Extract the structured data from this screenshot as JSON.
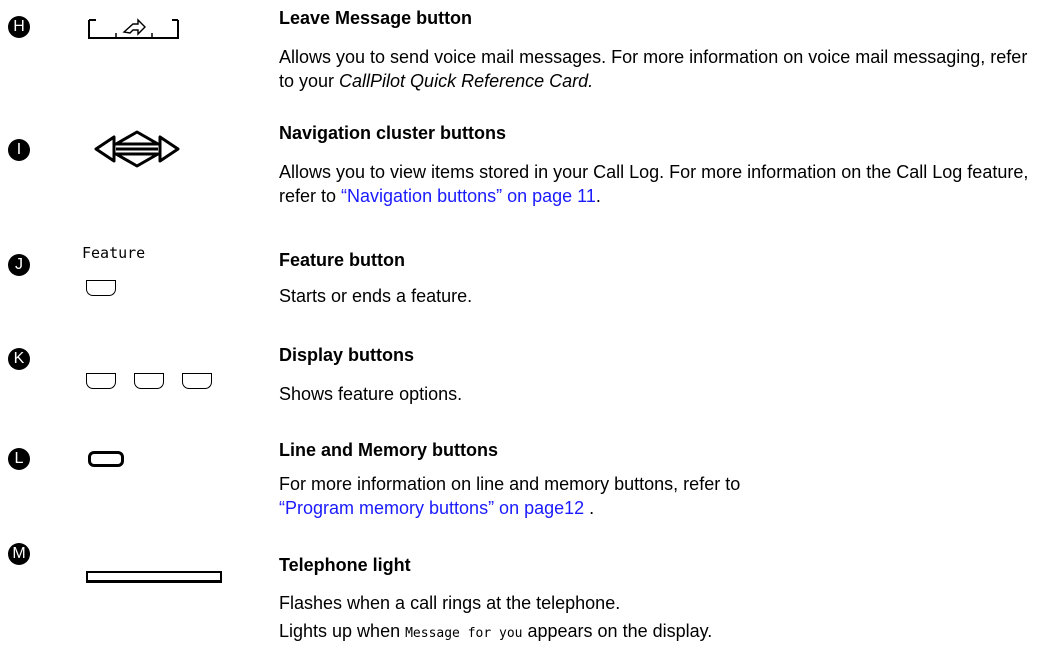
{
  "items": [
    {
      "badge": "H",
      "title": "Leave Message button",
      "text_before": "Allows you to send voice mail messages. For more information on voice mail messaging, refer to your ",
      "italic_text": "CallPilot Quick Reference Card."
    },
    {
      "badge": "I",
      "title": "Navigation cluster buttons",
      "text_before": "Allows you to view items stored in your Call Log. For more information on the Call Log feature, refer to ",
      "link_text": "“Navigation buttons” on page 11",
      "text_after": "."
    },
    {
      "badge": "J",
      "icon_label": "Feature",
      "title": "Feature button",
      "text": "Starts or ends a feature."
    },
    {
      "badge": "K",
      "title": "Display buttons",
      "text": "Shows feature options."
    },
    {
      "badge": "L",
      "title": "Line and Memory buttons",
      "text_before": "For more information on line and memory buttons, refer to ",
      "link_text": "“Program memory buttons” on page12",
      "text_after": " ."
    },
    {
      "badge": "M",
      "title": "Telephone light",
      "text_line1": "Flashes when a call rings at the telephone.",
      "text_line2_before": "Lights up when ",
      "text_line2_code": "Message for you",
      "text_line2_after": " appears on the display."
    }
  ],
  "colors": {
    "link": "#1a1aff",
    "badge_bg": "#000000",
    "badge_text": "#ffffff"
  }
}
